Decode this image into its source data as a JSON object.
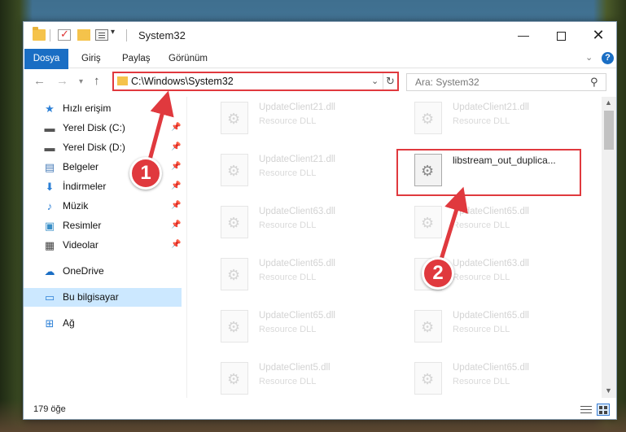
{
  "window": {
    "title": "System32"
  },
  "ribbon": {
    "tabs": [
      "Dosya",
      "Giriş",
      "Paylaş",
      "Görünüm"
    ],
    "help_label": "?"
  },
  "address": {
    "path": "C:\\Windows\\System32",
    "search_placeholder": "Ara: System32"
  },
  "nav_pane": {
    "items": [
      {
        "label": "Hızlı erişim",
        "icon": "star-icon",
        "pinned": false
      },
      {
        "label": "Yerel Disk (C:)",
        "icon": "drive-icon",
        "pinned": true
      },
      {
        "label": "Yerel Disk (D:)",
        "icon": "drive-icon",
        "pinned": true
      },
      {
        "label": "Belgeler",
        "icon": "document-icon",
        "pinned": true
      },
      {
        "label": "İndirmeler",
        "icon": "download-icon",
        "pinned": true
      },
      {
        "label": "Müzik",
        "icon": "music-icon",
        "pinned": true
      },
      {
        "label": "Resimler",
        "icon": "pictures-icon",
        "pinned": true
      },
      {
        "label": "Videolar",
        "icon": "video-icon",
        "pinned": true
      },
      {
        "label": "OneDrive",
        "icon": "cloud-icon",
        "pinned": false
      },
      {
        "label": "Bu bilgisayar",
        "icon": "computer-icon",
        "pinned": false,
        "selected": true
      },
      {
        "label": "Ağ",
        "icon": "network-icon",
        "pinned": false
      }
    ]
  },
  "files": [
    {
      "name": "UpdateClient21.dll",
      "type": "Resource DLL"
    },
    {
      "name": "UpdateClient21.dll",
      "type": "Resource DLL"
    },
    {
      "name": "UpdateClient21.dll",
      "type": "Resource DLL"
    },
    {
      "name": "libstream_out_duplica...",
      "type": "",
      "focus": true
    },
    {
      "name": "UpdateClient63.dll",
      "type": "Resource DLL"
    },
    {
      "name": "UpdateClient65.dll",
      "type": "Resource DLL"
    },
    {
      "name": "UpdateClient65.dll",
      "type": "Resource DLL"
    },
    {
      "name": "UpdateClient63.dll",
      "type": "Resource DLL"
    },
    {
      "name": "UpdateClient65.dll",
      "type": "Resource DLL"
    },
    {
      "name": "UpdateClient65.dll",
      "type": "Resource DLL"
    },
    {
      "name": "UpdateClient5.dll",
      "type": "Resource DLL"
    },
    {
      "name": "UpdateClient65.dll",
      "type": "Resource DLL"
    }
  ],
  "status": {
    "item_count": "179 öğe"
  },
  "annotations": {
    "badge1": "1",
    "badge2": "2"
  },
  "colors": {
    "accent": "#1a6ec4",
    "highlight": "#e0393e",
    "selection": "#cce8ff"
  }
}
